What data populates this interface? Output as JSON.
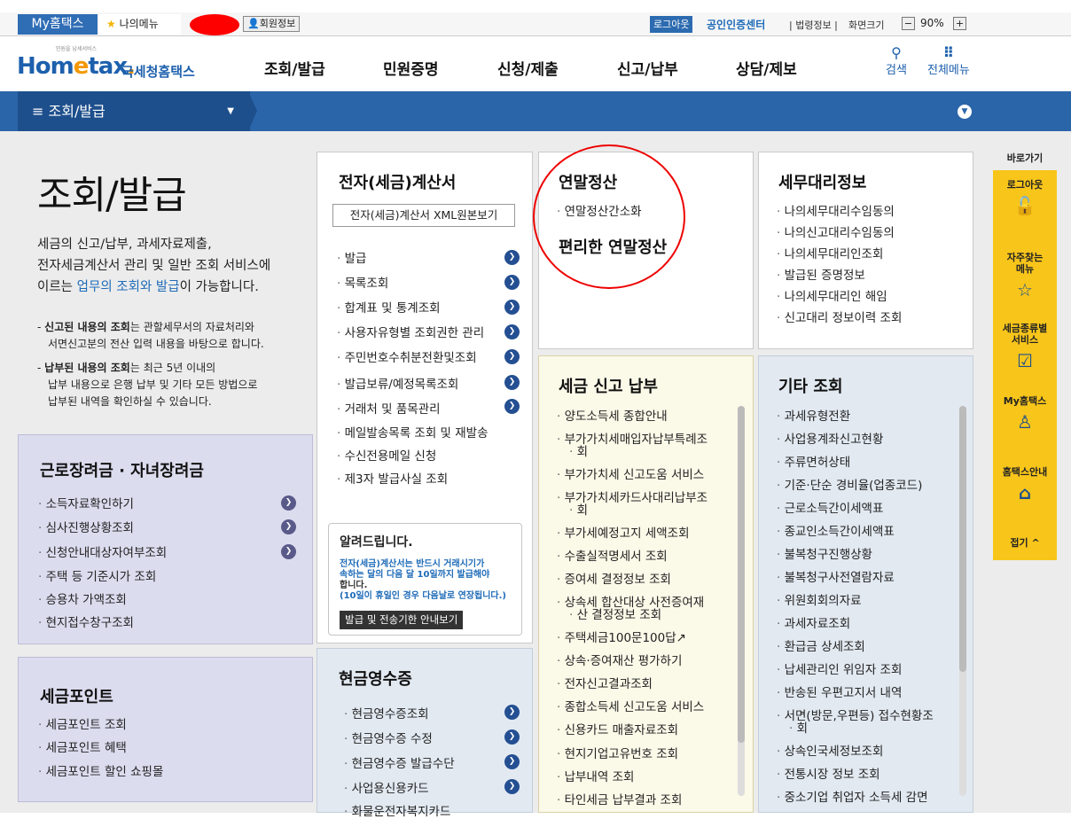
{
  "topbar": {
    "myhometax": "My홈택스",
    "mymenu": "나의메뉴",
    "member_info": "회원정보",
    "logout": "로그아웃",
    "cert_center": "공인인증센터",
    "legal": "법령정보",
    "screen_size": "화면크기",
    "zoom": "90%"
  },
  "header": {
    "logo_small": "민원을 납세서비스",
    "logo_home": "Hom",
    "logo_e": "e",
    "logo_tax": "tax",
    "logo_dot": ".",
    "logo_kr": "국세청홈택스",
    "gnb": [
      "조회/발급",
      "민원증명",
      "신청/제출",
      "신고/납부",
      "상담/제보"
    ],
    "search": "검색",
    "all_menu": "전체메뉴"
  },
  "navbar": {
    "current": "조회/발급"
  },
  "intro": {
    "title": "조회/발급",
    "text_1": "세금의 신고/납부, 과세자료제출,",
    "text_2": "전자세금계산서 관리 및 일반 조회 서비스에",
    "text_3_pre": "이르는 ",
    "text_3_hl": "업무의 조회와 발급",
    "text_3_post": "이 가능합니다.",
    "note1_bold": "신고된 내용의 조회",
    "note1_rest": "는 관할세무서의 자료처리와",
    "note1_line2": "서면신고분의 전산 입력 내용을 바탕으로 합니다.",
    "note2_bold": "납부된 내용의 조회",
    "note2_rest": "는 최근 5년 이내의",
    "note2_line2": "납부 내용으로 은행 납부 및 기타 모든 방법으로",
    "note2_line3": "납부된 내역을 확인하실 수 있습니다."
  },
  "labor": {
    "title": "근로장려금 · 자녀장려금",
    "items": [
      "소득자료확인하기",
      "심사진행상황조회",
      "신청안내대상자여부조회",
      "주택 등 기준시가 조회",
      "승용차 가액조회",
      "현지접수창구조회"
    ]
  },
  "point": {
    "title": "세금포인트",
    "items": [
      "세금포인트 조회",
      "세금포인트 혜택",
      "세금포인트 할인 쇼핑몰"
    ]
  },
  "einvoice": {
    "title": "전자(세금)계산서",
    "xml_button": "전자(세금)계산서 XML원본보기",
    "items": [
      "발급",
      "목록조회",
      "합계표 및 통계조회",
      "사용자유형별 조회권한 관리",
      "주민번호수취분전환및조회",
      "발급보류/예정목록조회",
      "거래처 및 품목관리",
      "메일발송목록 조회 및 재발송",
      "수신전용메일 신청",
      "제3자 발급사실 조회"
    ],
    "notice_title": "알려드립니다.",
    "notice_l1": "전자(세금)계산서는 반드시 거래시기가",
    "notice_l2": "속하는 달의 다음 달 10일까지 발급해야",
    "notice_l3": "합니다.",
    "notice_l4": "(10일이 휴일인 경우 다음날로 연장됩니다.)",
    "notice_button": "발급 및 전송기한 안내보기"
  },
  "cash": {
    "title": "현금영수증",
    "items": [
      "현금영수증조회",
      "현금영수증 수정",
      "현금영수증 발급수단",
      "사업용신용카드",
      "화물운전자복지카드"
    ]
  },
  "yearend": {
    "title": "연말정산",
    "item": "연말정산간소화",
    "subtitle": "편리한 연말정산"
  },
  "agent": {
    "title": "세무대리정보",
    "items": [
      "나의세무대리수임동의",
      "나의신고대리수임동의",
      "나의세무대리인조회",
      "발급된 증명정보",
      "나의세무대리인 해임",
      "신고대리 정보이력 조회"
    ]
  },
  "taxpay": {
    "title": "세금 신고 납부",
    "items": [
      "양도소득세 종합안내",
      "부가가치세매입자납부특례조",
      "회",
      "부가가치세 신고도움 서비스",
      "부가가치세카드사대리납부조",
      "회",
      "부가세예정고지 세액조회",
      "수출실적명세서 조회",
      "증여세 결정정보 조회",
      "상속세 합산대상 사전증여재",
      "산 결정정보 조회",
      "주택세금100문100답",
      "상속·증여재산 평가하기",
      "전자신고결과조회",
      "종합소득세 신고도움 서비스",
      "신용카드 매출자료조회",
      "현지기업고유번호 조회",
      "납부내역 조회",
      "타인세금 납부결과 조회"
    ]
  },
  "other": {
    "title": "기타 조회",
    "items": [
      "과세유형전환",
      "사업용계좌신고현황",
      "주류면허상태",
      "기준·단순 경비율(업종코드)",
      "근로소득간이세액표",
      "종교인소득간이세액표",
      "불복청구진행상황",
      "불복청구사전열람자료",
      "위원회회의자료",
      "과세자료조회",
      "환급금 상세조회",
      "납세관리인 위임자 조회",
      "반송된 우편고지서 내역",
      "서면(방문,우편등) 접수현황조",
      "회",
      "상속인국세정보조회",
      "전통시장 정보 조회",
      "중소기업 취업자 소득세 감면"
    ]
  },
  "quick": {
    "title": "바로가기",
    "logout": "로그아웃",
    "faq_1": "자주찾는",
    "faq_2": "메뉴",
    "taxtype_1": "세금종류별",
    "taxtype_2": "서비스",
    "my": "My홈택스",
    "guide": "홈택스안내",
    "fold": "접기"
  }
}
